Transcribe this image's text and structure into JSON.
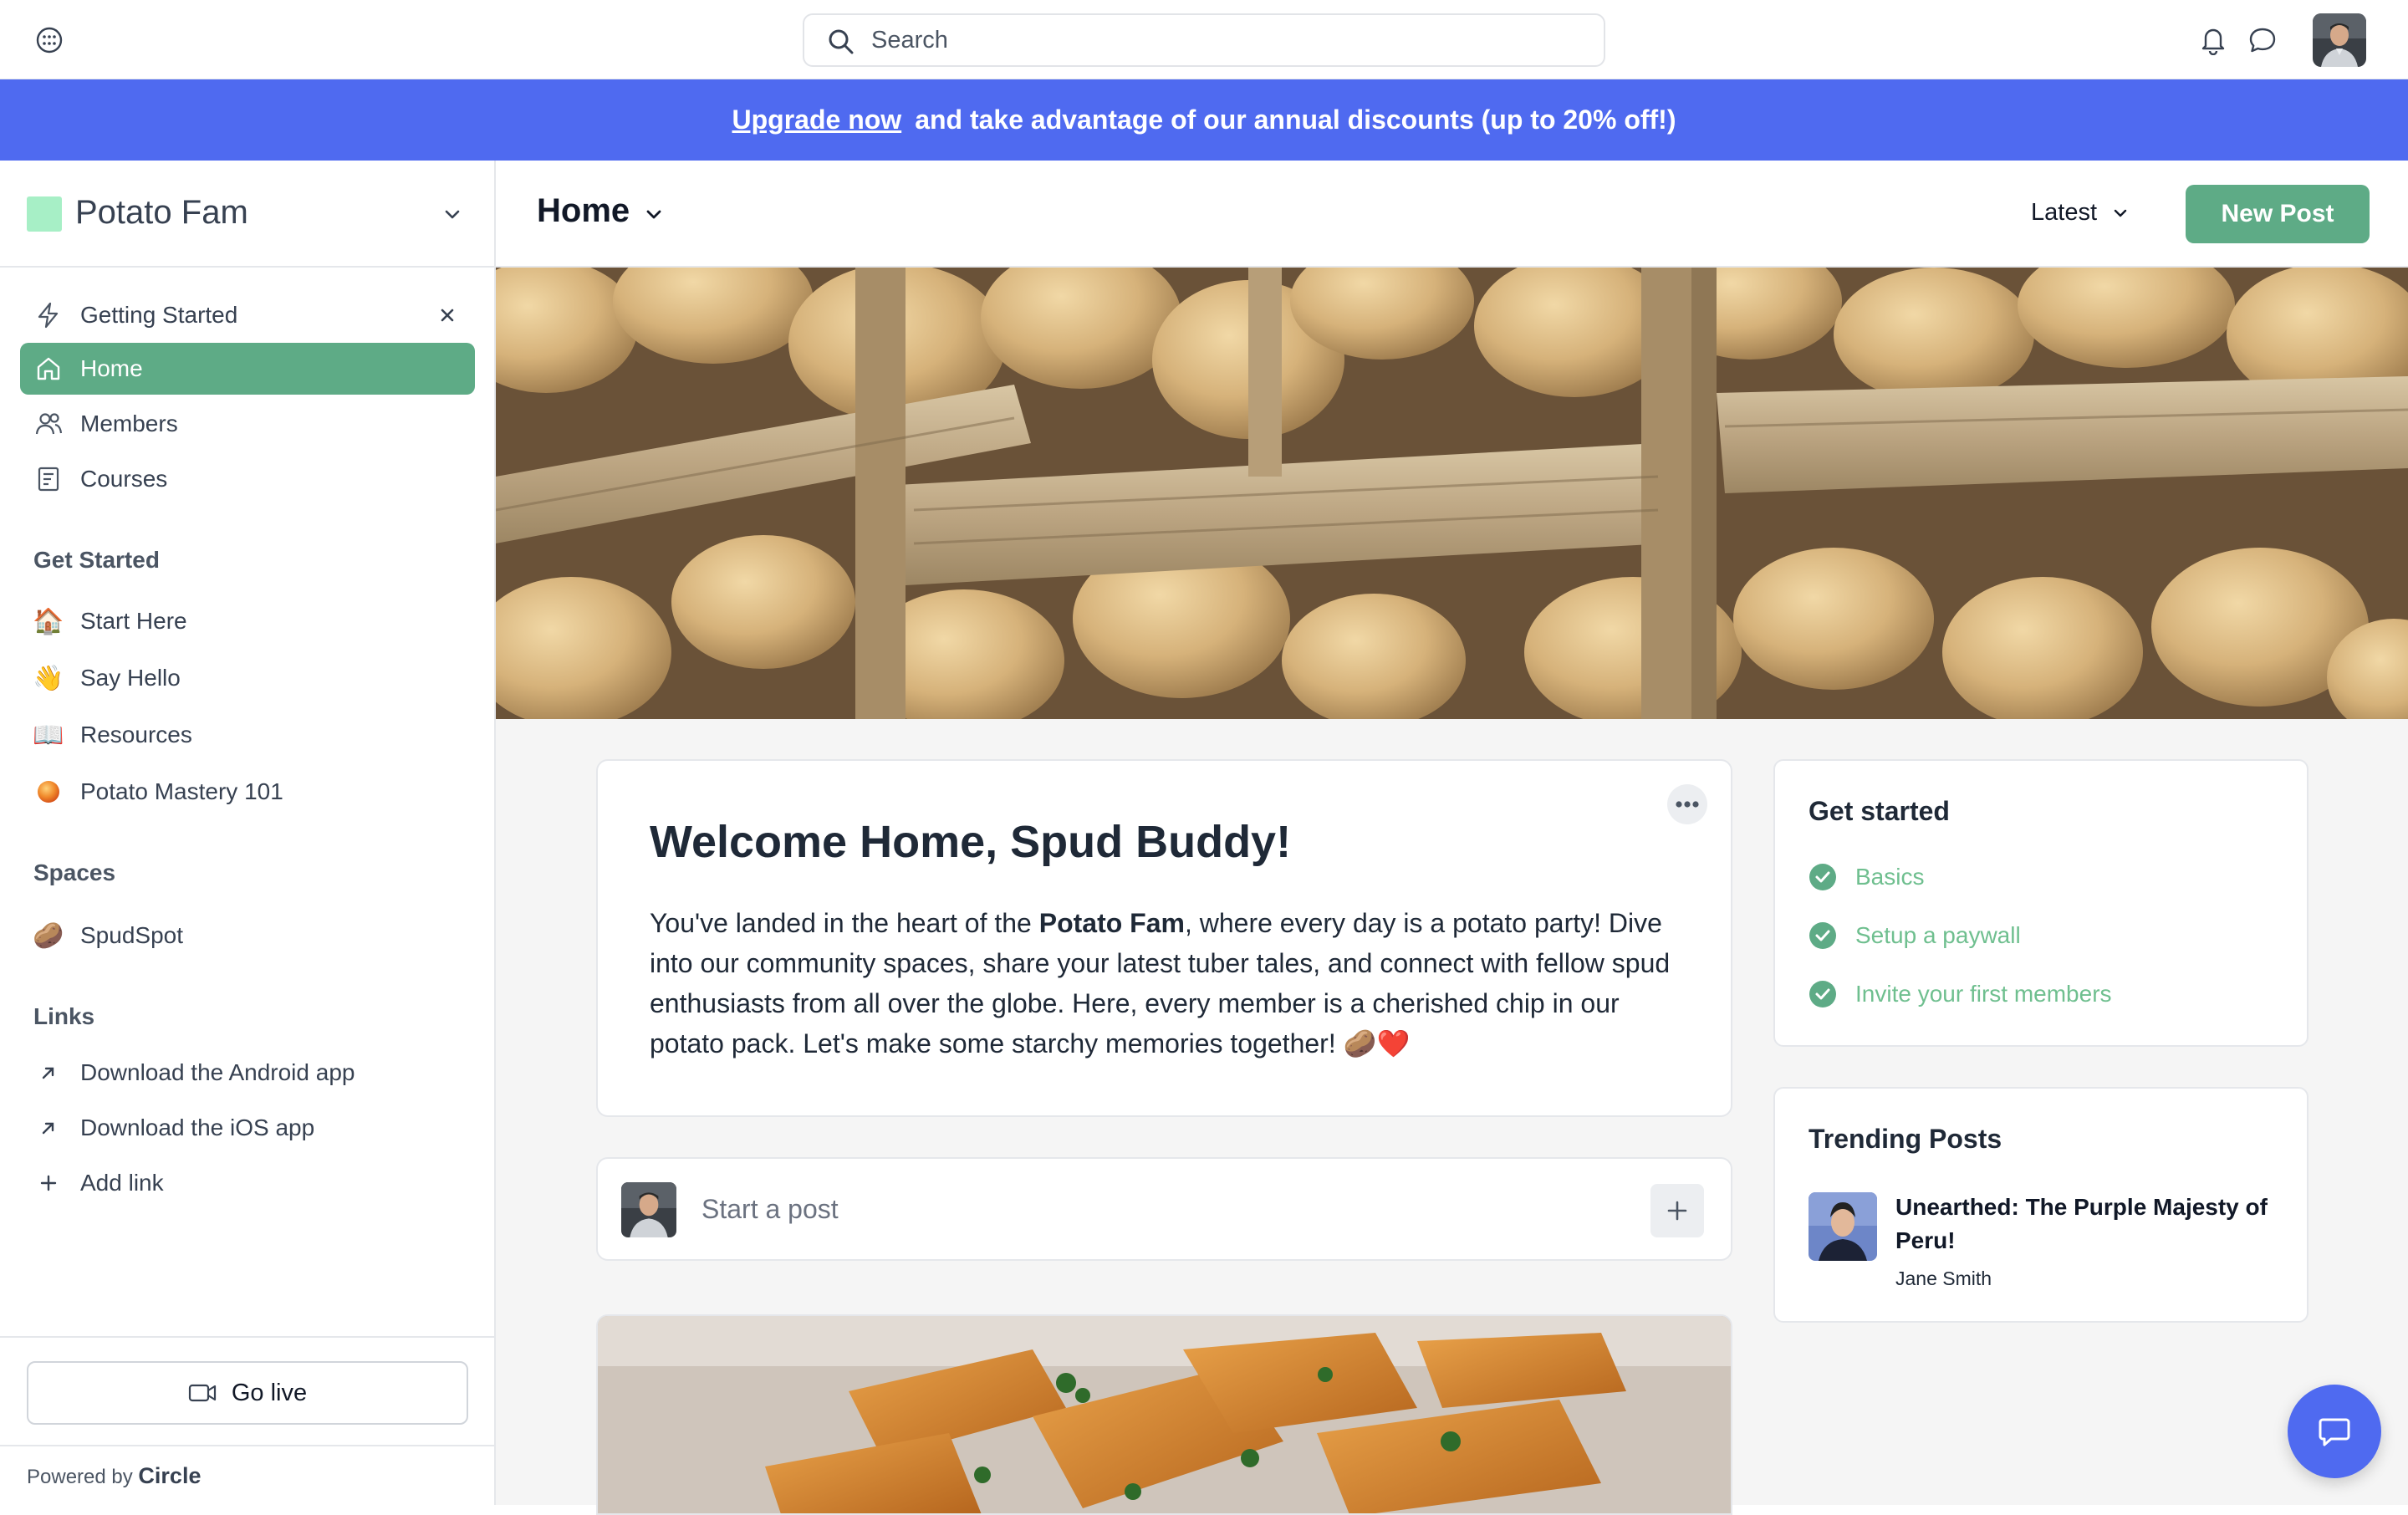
{
  "topbar": {
    "search_placeholder": "Search",
    "icons": [
      "menu-dots-icon",
      "search-icon",
      "bell-icon",
      "chat-bubble-icon"
    ]
  },
  "banner": {
    "link_text": "Upgrade now",
    "text": "and take advantage of our annual discounts (up to 20% off!)",
    "background": "#4f6af0"
  },
  "sidebar": {
    "community_name": "Potato Fam",
    "nav": [
      {
        "label": "Getting Started",
        "icon": "lightning-icon"
      },
      {
        "label": "Home",
        "icon": "home-icon",
        "active": true
      },
      {
        "label": "Members",
        "icon": "members-icon"
      },
      {
        "label": "Courses",
        "icon": "courses-icon"
      }
    ],
    "sections": {
      "get_started": "Get Started",
      "spaces": "Spaces",
      "links": "Links"
    },
    "get_started_items": [
      {
        "label": "Start Here",
        "emoji": "🏠"
      },
      {
        "label": "Say Hello",
        "emoji": "👋"
      },
      {
        "label": "Resources",
        "emoji": "📖"
      },
      {
        "label": "Potato Mastery 101",
        "emoji": "🟠"
      }
    ],
    "spaces_items": [
      {
        "label": "SpudSpot",
        "emoji": "🥔"
      }
    ],
    "links_items": [
      {
        "label": "Download the Android app"
      },
      {
        "label": "Download the iOS app"
      },
      {
        "label": "Add link"
      }
    ],
    "go_live": "Go live",
    "powered_by": "Powered by",
    "powered_brand": "Circle"
  },
  "main": {
    "title": "Home",
    "sort_label": "Latest",
    "new_post": "New Post"
  },
  "welcome": {
    "heading": "Welcome Home, Spud Buddy!",
    "body_pre": "You've landed in the heart of the ",
    "body_bold": "Potato Fam",
    "body_post": ", where every day is a potato party! Dive into our community spaces, share your latest tuber tales, and connect with fellow spud enthusiasts from all over the globe. Here, every member is a cherished chip in our potato pack. Let's make some starchy memories together! 🥔❤️"
  },
  "composer": {
    "placeholder": "Start a post"
  },
  "get_started_widget": {
    "title": "Get started",
    "items": [
      "Basics",
      "Setup a paywall",
      "Invite your first members"
    ],
    "color": "#6fbf8f"
  },
  "trending": {
    "title": "Trending Posts",
    "post_title": "Unearthed: The Purple Majesty of Peru!",
    "author": "Jane Smith"
  },
  "colors": {
    "accent_green": "#5eab86",
    "brand_blue": "#4f6af0",
    "community_logo": "#a7efc6"
  }
}
